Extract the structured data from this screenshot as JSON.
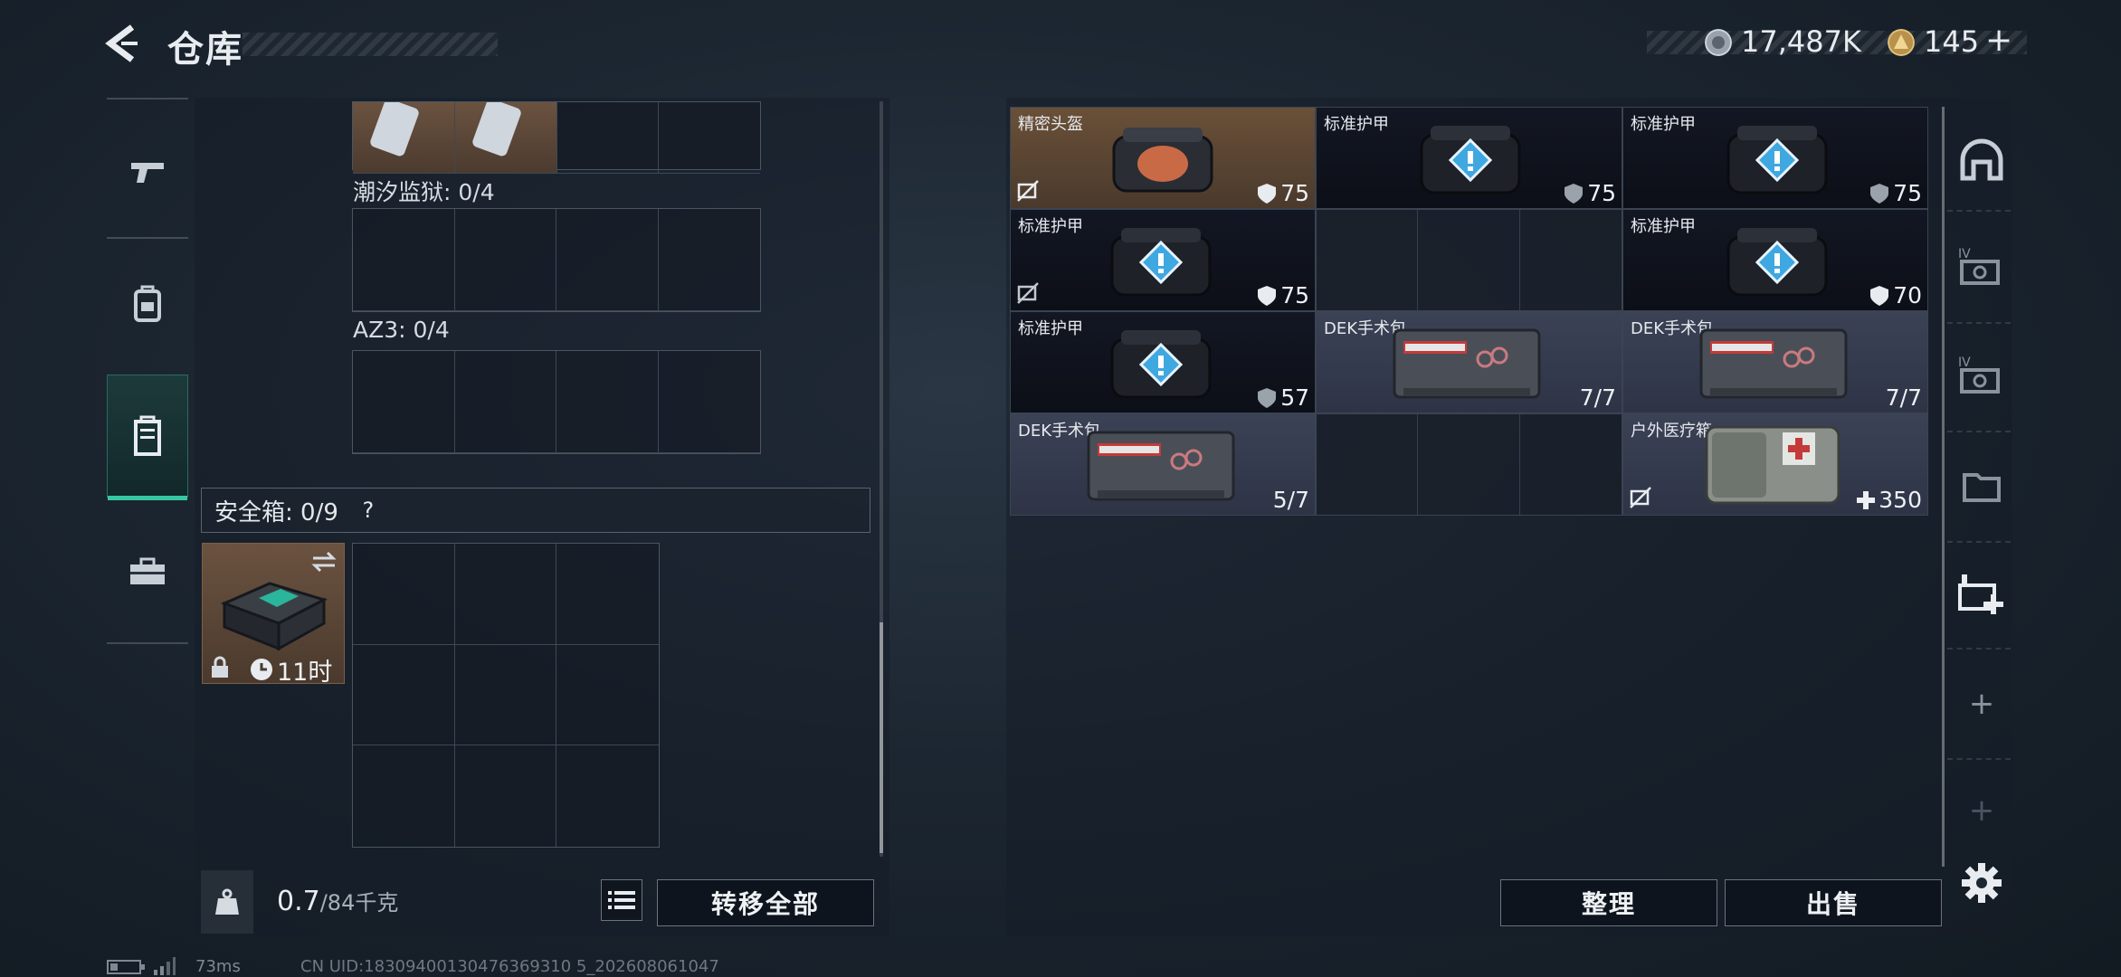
{
  "header": {
    "title": "仓库",
    "currency_1": "17,487K",
    "currency_2": "145",
    "add_label": "+"
  },
  "left_panel": {
    "slots": [
      {
        "label": "潮汐监狱: 0/4"
      },
      {
        "label": "AZ3: 0/4"
      }
    ],
    "safe_box": {
      "label": "安全箱: 0/9",
      "help": "?",
      "timer": "11时"
    },
    "weight_value": "0.7",
    "weight_max": "/84千克",
    "transfer_all": "转移全部"
  },
  "right_panel": {
    "items": [
      {
        "name": "精密头盔",
        "value": "75"
      },
      {
        "name": "标准护甲",
        "value": "75"
      },
      {
        "name": "标准护甲",
        "value": "75"
      },
      {
        "name": "标准护甲",
        "value": "75"
      },
      {
        "name": "标准护甲",
        "value": "70"
      },
      {
        "name": "标准护甲",
        "value": "57"
      },
      {
        "name": "DEK手术包",
        "value": "7/7"
      },
      {
        "name": "DEK手术包",
        "value": "7/7"
      },
      {
        "name": "DEK手术包",
        "value": "5/7"
      },
      {
        "name": "户外医疗箱",
        "value": "350"
      }
    ],
    "organize": "整理",
    "sell": "出售"
  },
  "status_bar": {
    "ping": "73ms",
    "uid": "CN UID:18309400130476369310 5_202608061047"
  },
  "colors": {
    "accent_active": "#35c8a0",
    "gold_item": "#6a5038",
    "armor_icon": "#3fa8e0"
  }
}
